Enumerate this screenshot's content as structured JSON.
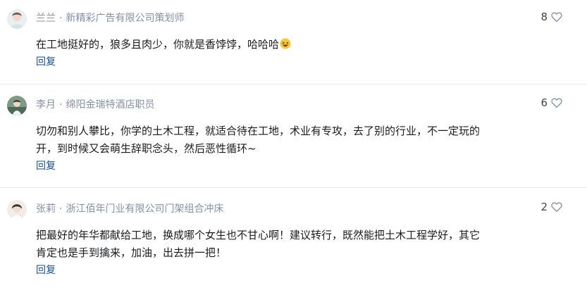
{
  "comments": [
    {
      "author": "兰兰",
      "separator": "·",
      "title": "新精彩广告有限公司策划师",
      "text": "在工地挺好的，狼多且肉少，你就是香饽饽，哈哈哈",
      "emoji": "laughing-emoji",
      "likes": "8",
      "reply_label": "回复"
    },
    {
      "author": "李月",
      "separator": "·",
      "title": "绵阳金瑞特酒店职员",
      "text_line1": "切勿和别人攀比，你学的土木工程，就适合待在工地，术业有专攻，去了别的行业，不一定玩的",
      "text_line2": "开，到时候又会萌生辞职念头，然后恶性循环~",
      "likes": "6",
      "reply_label": "回复"
    },
    {
      "author": "张莉",
      "separator": "·",
      "title": "浙江佰年门业有限公司门架组合冲床",
      "text_line1": "把最好的年华都献给工地，换成哪个女生也不甘心啊！建议转行，既然能把土木工程学好，其它",
      "text_line2": "肯定也是手到擒来，加油，出去拼一把！",
      "likes": "2",
      "reply_label": "回复"
    }
  ],
  "colors": {
    "meta": "#8590a6",
    "reply": "#175199",
    "text": "#191b1f",
    "divider": "#ebebeb"
  },
  "icons": {
    "like": "heart-outline-icon"
  }
}
